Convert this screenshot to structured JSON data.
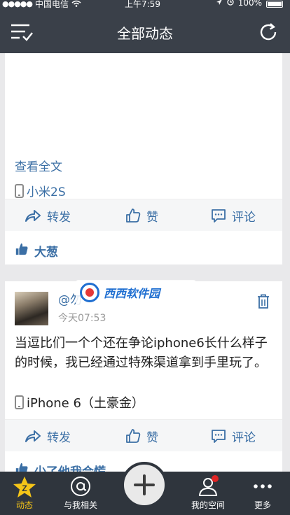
{
  "status_bar": {
    "signal_dots": "●●●●●",
    "carrier": "中国电信",
    "time": "上午7:59",
    "battery_percent": "100%",
    "battery_level": 1.0
  },
  "nav": {
    "title": "全部动态"
  },
  "post1": {
    "read_more": "查看全文",
    "device": "小米2S",
    "actions": {
      "repost": "转发",
      "like": "赞",
      "comment": "评论"
    },
    "liked_by": "大葱"
  },
  "post2": {
    "author": "@勿",
    "time": "今天07:53",
    "text": "当逗比们一个个还在争论iphone6长什么样子的时候，我已经通过特殊渠道拿到手里玩了。",
    "device": "iPhone 6（土豪金）",
    "actions": {
      "repost": "转发",
      "like": "赞",
      "comment": "评论"
    },
    "liked_by_partial": "少了他我会慌"
  },
  "watermark": {
    "text": "西西软件园"
  },
  "tabs": [
    {
      "label": "动态",
      "icon": "z-star-icon",
      "active": true
    },
    {
      "label": "与我相关",
      "icon": "at-icon",
      "active": false
    },
    {
      "label": "我的空间",
      "icon": "person-icon",
      "active": false,
      "badge": true
    },
    {
      "label": "更多",
      "icon": "more-dots-icon",
      "active": false
    }
  ],
  "colors": {
    "header_bg": "#3a4049",
    "tab_bar_bg": "#2f353d",
    "link_blue": "#3b6fa5",
    "active_tab": "#f5c518",
    "badge_red": "#e02424"
  }
}
